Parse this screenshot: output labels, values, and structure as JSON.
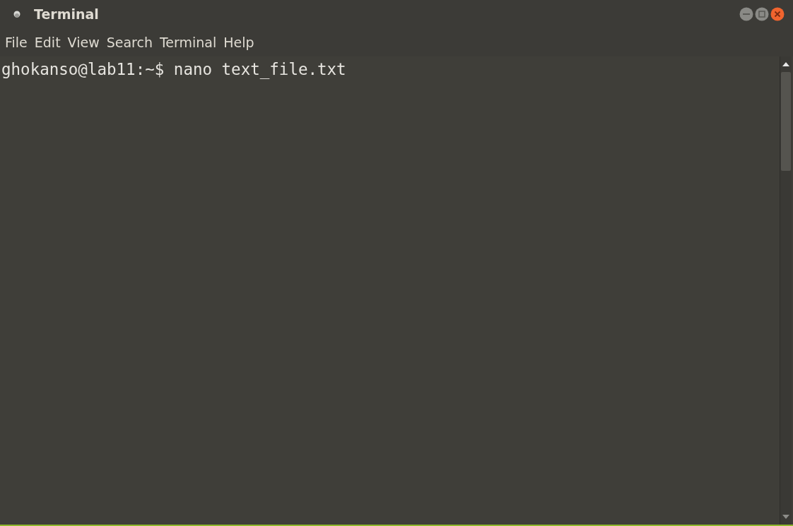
{
  "window": {
    "title": "Terminal"
  },
  "menu": [
    "File",
    "Edit",
    "View",
    "Search",
    "Terminal",
    "Help"
  ],
  "terminal": {
    "lines": [
      "ghokanso@lab11:~$ nano text_file.txt"
    ]
  }
}
